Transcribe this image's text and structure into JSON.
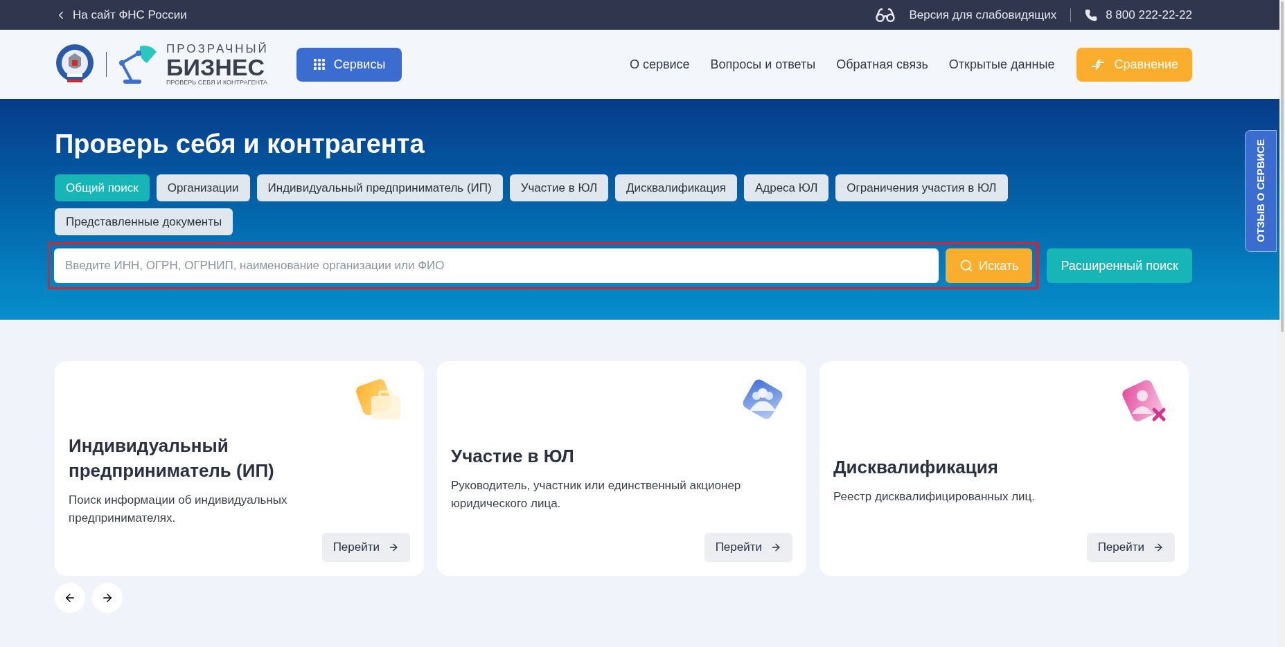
{
  "top_bar": {
    "back_link": "На сайт ФНС России",
    "accessibility_link": "Версия для слабовидящих",
    "phone": "8 800 222-22-22"
  },
  "header": {
    "logo": {
      "line1": "ПРОЗРАЧНЫЙ",
      "line2": "БИЗНЕС",
      "tagline": "ПРОВЕРЬ СЕБЯ И КОНТРАГЕНТА"
    },
    "services_button": "Сервисы",
    "nav": [
      "О сервисе",
      "Вопросы и ответы",
      "Обратная связь",
      "Открытые данные"
    ],
    "compare_button": "Сравнение"
  },
  "hero": {
    "title": "Проверь себя и контрагента",
    "tabs": [
      {
        "label": "Общий поиск",
        "selected": true
      },
      {
        "label": "Организации",
        "selected": false
      },
      {
        "label": "Индивидуальный предприниматель (ИП)",
        "selected": false
      },
      {
        "label": "Участие в ЮЛ",
        "selected": false
      },
      {
        "label": "Дисквалификация",
        "selected": false
      },
      {
        "label": "Адреса ЮЛ",
        "selected": false
      },
      {
        "label": "Ограничения участия в ЮЛ",
        "selected": false
      },
      {
        "label": "Представленные документы",
        "selected": false
      }
    ],
    "search": {
      "placeholder": "Введите ИНН, ОГРН, ОГРНИП, наименование организации или ФИО",
      "button": "Искать"
    },
    "advanced_search_button": "Расширенный поиск"
  },
  "feedback_tab": "ОТЗЫВ О СЕРВИСЕ",
  "cards": [
    {
      "kind": "briefcase",
      "title": "Индивидуальный предприниматель (ИП)",
      "description": "Поиск информации об индивидуальных предпринимателях.",
      "button": "Перейти"
    },
    {
      "kind": "people",
      "title": "Участие в ЮЛ",
      "description": "Руководитель, участник или единственный акционер юридического лица.",
      "button": "Перейти"
    },
    {
      "kind": "disqualified",
      "title": "Дисквалификация",
      "description": "Реестр дисквалифицированных лиц.",
      "button": "Перейти"
    }
  ]
}
